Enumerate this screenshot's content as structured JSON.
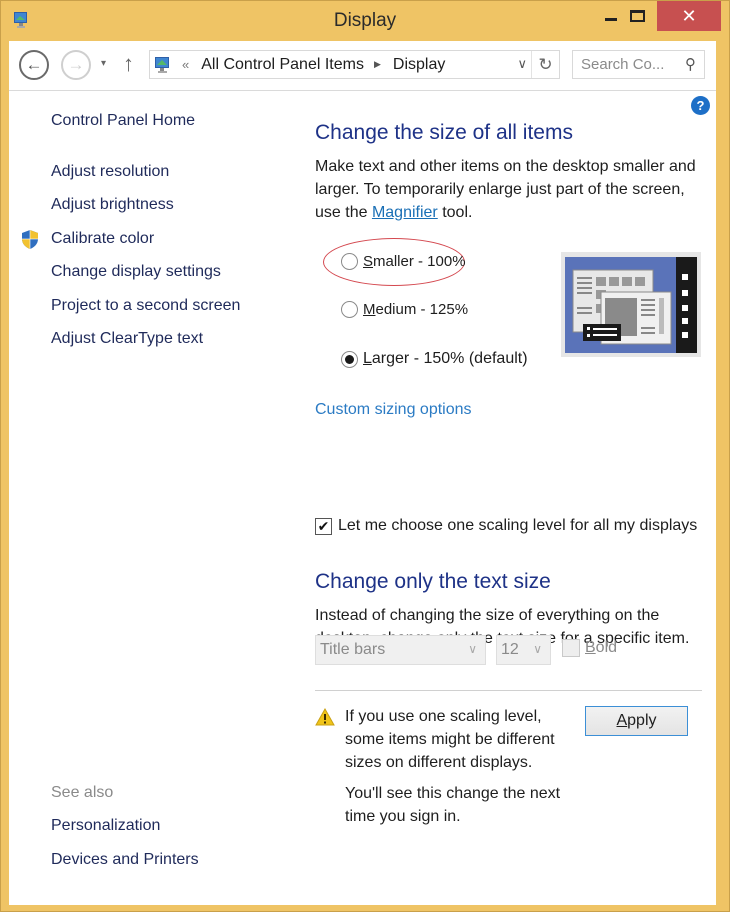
{
  "window": {
    "title": "Display",
    "controls": {
      "minimize": "minimize",
      "maximize": "maximize",
      "close": "✕"
    }
  },
  "navbar": {
    "back_icon": "←",
    "forward_icon": "→",
    "recent_icon": "▾",
    "up_icon": "↑",
    "address": {
      "overflow": "«",
      "breadcrumbs": [
        "All Control Panel Items",
        "Display"
      ],
      "separator": "▶",
      "dropdown_icon": "∨",
      "refresh_icon": "↻"
    },
    "search": {
      "placeholder": "Search Co...",
      "icon": "⚲"
    }
  },
  "help_icon": "?",
  "left_pane": {
    "home": "Control Panel Home",
    "tasks": [
      {
        "label": "Adjust resolution",
        "shield": false
      },
      {
        "label": "Adjust brightness",
        "shield": false
      },
      {
        "label": "Calibrate color",
        "shield": true
      },
      {
        "label": "Change display settings",
        "shield": false
      },
      {
        "label": "Project to a second screen",
        "shield": false
      },
      {
        "label": "Adjust ClearType text",
        "shield": false
      }
    ],
    "see_also_heading": "See also",
    "see_also": [
      "Personalization",
      "Devices and Printers"
    ]
  },
  "main": {
    "section1": {
      "heading": "Change the size of all items",
      "description_before": "Make text and other items on the desktop smaller and larger. To temporarily enlarge just part of the screen, use the ",
      "magnifier_link": "Magnifier",
      "description_after": " tool.",
      "options": [
        {
          "accel": "S",
          "rest": "maller - 100%",
          "checked": false,
          "highlighted": true
        },
        {
          "accel": "M",
          "rest": "edium - 125%",
          "checked": false,
          "highlighted": false
        },
        {
          "accel": "L",
          "rest": "arger - 150% (default)",
          "checked": true,
          "highlighted": false
        }
      ],
      "custom_sizing_link": "Custom sizing options",
      "one_scaling_checkbox": {
        "label": "Let me choose one scaling level for all my displays",
        "checked": true,
        "check_glyph": "✔"
      }
    },
    "section2": {
      "heading": "Change only the text size",
      "description": "Instead of changing the size of everything on the desktop, change only the text size for a specific item.",
      "item_select": {
        "value": "Title bars",
        "chevron": "∨",
        "disabled": true
      },
      "size_select": {
        "value": "12",
        "chevron": "∨",
        "disabled": true
      },
      "bold_checkbox": {
        "accel": "B",
        "rest": "old",
        "checked": false,
        "disabled": true
      }
    },
    "warning": {
      "text": "If you use one scaling level, some items might be different sizes on different displays.",
      "note": "You'll see this change the next time you sign in."
    },
    "apply_button": {
      "accel": "A",
      "rest": "pply"
    }
  },
  "colors": {
    "frame": "#efc465",
    "close_button": "#c75050",
    "heading": "#1e3287",
    "link": "#1a6fb5",
    "left_link": "#1f2a5a",
    "highlight_ellipse": "#d4484f"
  }
}
